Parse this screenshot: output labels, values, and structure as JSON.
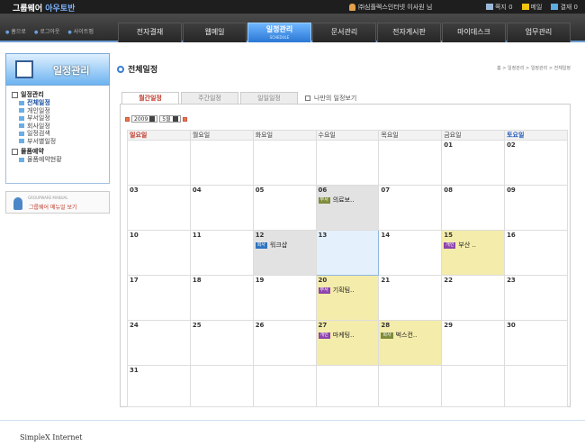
{
  "app": {
    "logo_main": "그룹웨어",
    "logo_sub": "아우토반",
    "user": "㈜심플렉스인터넷 이사원 님"
  },
  "top_links": [
    {
      "label": "쪽지 0",
      "color": "#9bb8d9"
    },
    {
      "label": "메일",
      "color": "#f1c40f"
    },
    {
      "label": "결재 0",
      "color": "#5dade2"
    }
  ],
  "utility": [
    "홈으로",
    "로그아웃",
    "사이트맵"
  ],
  "menu": [
    {
      "label": "전자결재"
    },
    {
      "label": "웹메일"
    },
    {
      "label": "일정관리",
      "sub": "SCHEDULE",
      "active": true
    },
    {
      "label": "문서관리"
    },
    {
      "label": "전자게시판"
    },
    {
      "label": "마이데스크"
    },
    {
      "label": "업무관리"
    }
  ],
  "sidebar": {
    "title": "일정관리",
    "groups": [
      {
        "label": "일정관리",
        "items": [
          "전체일정",
          "개인일정",
          "부서일정",
          "회사일정",
          "일정검색",
          "부서별일정"
        ]
      },
      {
        "label": "물품예약",
        "items": [
          "물품예약현황"
        ]
      }
    ],
    "manual_small": "GROUPWARE MANUAL",
    "manual_label": "그룹웨어 메뉴얼 보기"
  },
  "page": {
    "title": "전체일정",
    "breadcrumb": "홈 > 일정관리 > 일정관리 > 전체일정"
  },
  "tabs": [
    {
      "label": "월간일정",
      "active": true
    },
    {
      "label": "주간일정"
    },
    {
      "label": "일일일정"
    }
  ],
  "only_mine_label": "나만의 일정보기",
  "selector": {
    "year": "2009",
    "month": "5월"
  },
  "weekdays": [
    "일요일",
    "월요일",
    "화요일",
    "수요일",
    "목요일",
    "금요일",
    "토요일"
  ],
  "weeks": [
    [
      {
        "d": ""
      },
      {
        "d": ""
      },
      {
        "d": ""
      },
      {
        "d": ""
      },
      {
        "d": ""
      },
      {
        "d": "01"
      },
      {
        "d": "02"
      }
    ],
    [
      {
        "d": "03"
      },
      {
        "d": "04"
      },
      {
        "d": "05"
      },
      {
        "d": "06",
        "style": "hl",
        "tag": "d",
        "tag_label": "부서",
        "text": "의료보.."
      },
      {
        "d": "07"
      },
      {
        "d": "08"
      },
      {
        "d": "09"
      }
    ],
    [
      {
        "d": "10"
      },
      {
        "d": "11"
      },
      {
        "d": "12",
        "style": "hl",
        "tag": "c",
        "tag_label": "회사",
        "text": "워크샵"
      },
      {
        "d": "13",
        "style": "today"
      },
      {
        "d": "14"
      },
      {
        "d": "15",
        "style": "ev",
        "tag": "p",
        "tag_label": "개인",
        "text": "부산 .."
      },
      {
        "d": "16"
      }
    ],
    [
      {
        "d": "17"
      },
      {
        "d": "18"
      },
      {
        "d": "19"
      },
      {
        "d": "20",
        "style": "ev",
        "tag": "b",
        "tag_label": "부서",
        "text": "기획팀.."
      },
      {
        "d": "21"
      },
      {
        "d": "22"
      },
      {
        "d": "23"
      }
    ],
    [
      {
        "d": "24"
      },
      {
        "d": "25"
      },
      {
        "d": "26"
      },
      {
        "d": "27",
        "style": "ev",
        "tag": "p",
        "tag_label": "개인",
        "text": "마케팅.."
      },
      {
        "d": "28",
        "style": "ev",
        "tag": "d",
        "tag_label": "회사",
        "text": "벅스컨.."
      },
      {
        "d": "29"
      },
      {
        "d": "30"
      }
    ],
    [
      {
        "d": "31"
      },
      {
        "d": ""
      },
      {
        "d": ""
      },
      {
        "d": ""
      },
      {
        "d": ""
      },
      {
        "d": ""
      },
      {
        "d": ""
      }
    ]
  ],
  "footer": "SimpleX Internet"
}
